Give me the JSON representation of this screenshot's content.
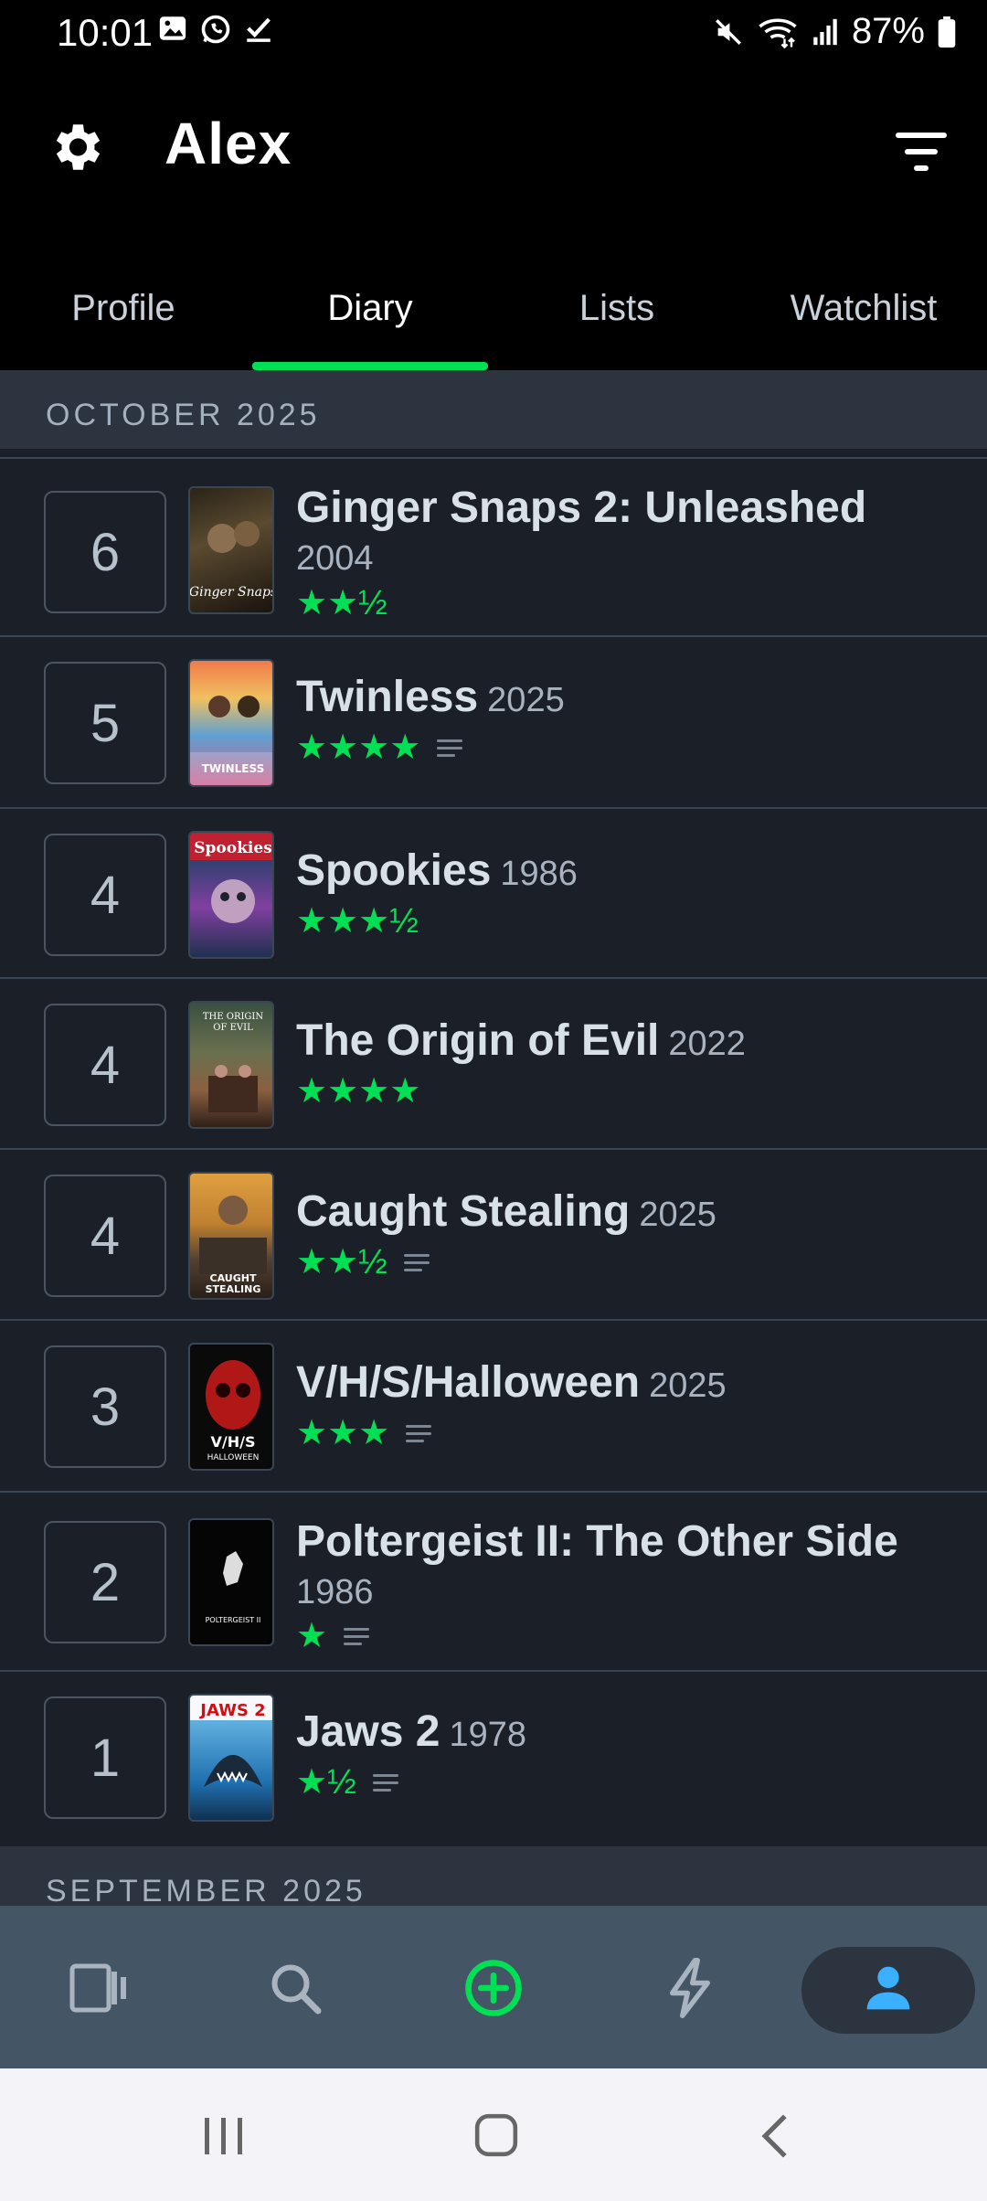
{
  "status": {
    "time": "10:01",
    "battery": "87%",
    "left_icons": [
      "gallery-icon",
      "whatsapp-icon",
      "check-icon"
    ],
    "right_icons": [
      "mute-icon",
      "wifi-icon",
      "signal-icon",
      "battery-icon"
    ]
  },
  "header": {
    "username": "Alex"
  },
  "tabs": [
    {
      "label": "Profile",
      "active": false
    },
    {
      "label": "Diary",
      "active": true
    },
    {
      "label": "Lists",
      "active": false
    },
    {
      "label": "Watchlist",
      "active": false
    }
  ],
  "accent_color": "#00e054",
  "sections": {
    "october": "OCTOBER 2025",
    "september": "SEPTEMBER 2025"
  },
  "entries": [
    {
      "day": "6",
      "title": "Ginger Snaps 2: Unleashed",
      "year": "2004",
      "stars": "★★½",
      "rating": 2.5,
      "has_review": false
    },
    {
      "day": "5",
      "title": "Twinless",
      "year": "2025",
      "stars": "★★★★",
      "rating": 4,
      "has_review": true
    },
    {
      "day": "4",
      "title": "Spookies",
      "year": "1986",
      "stars": "★★★½",
      "rating": 3.5,
      "has_review": false
    },
    {
      "day": "4",
      "title": "The Origin of Evil",
      "year": "2022",
      "stars": "★★★★",
      "rating": 4,
      "has_review": false
    },
    {
      "day": "4",
      "title": "Caught Stealing",
      "year": "2025",
      "stars": "★★½",
      "rating": 2.5,
      "has_review": true
    },
    {
      "day": "3",
      "title": "V/H/S/Halloween",
      "year": "2025",
      "stars": "★★★",
      "rating": 3,
      "has_review": true
    },
    {
      "day": "2",
      "title": "Poltergeist II: The Other Side",
      "year": "1986",
      "stars": "★",
      "rating": 1,
      "has_review": true
    },
    {
      "day": "1",
      "title": "Jaws 2",
      "year": "1978",
      "stars": "★½",
      "rating": 1.5,
      "has_review": true
    }
  ],
  "bottom_nav": [
    "films-icon",
    "search-icon",
    "add-circle-icon",
    "activity-icon",
    "profile-icon"
  ],
  "system_nav": [
    "recents-icon",
    "home-icon",
    "back-icon"
  ]
}
